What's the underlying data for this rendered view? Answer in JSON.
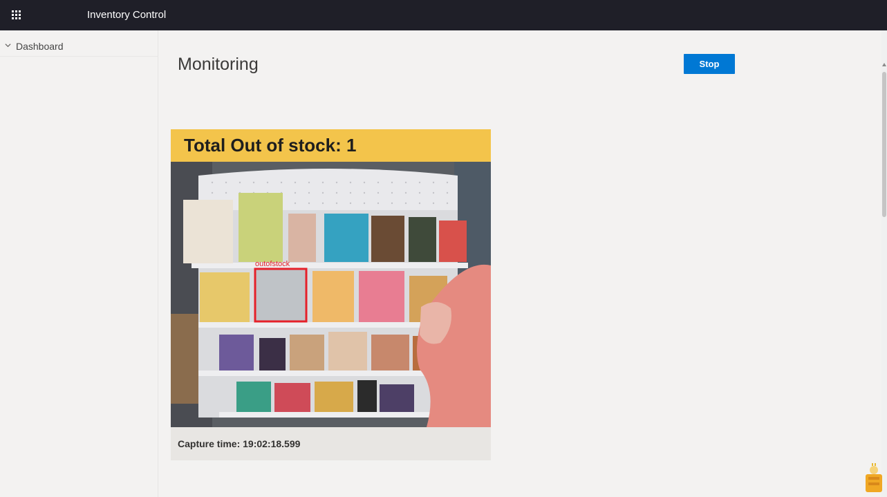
{
  "app": {
    "title": "Inventory Control",
    "launcher_icon": "waffle-icon"
  },
  "sidebar": {
    "items": [
      {
        "label": "Dashboard",
        "icon": "chevron-down-icon"
      }
    ]
  },
  "page": {
    "title": "Monitoring"
  },
  "toolbar": {
    "stop_label": "Stop"
  },
  "monitor": {
    "header": "Total Out of stock: 1",
    "detection_label": "outofstock",
    "capture_time": "Capture time: 19:02:18.599"
  },
  "colors": {
    "topbar": "#1f1f28",
    "accent": "#0078d4",
    "header_band": "#f3c44b",
    "detection_box": "#e5202a"
  }
}
